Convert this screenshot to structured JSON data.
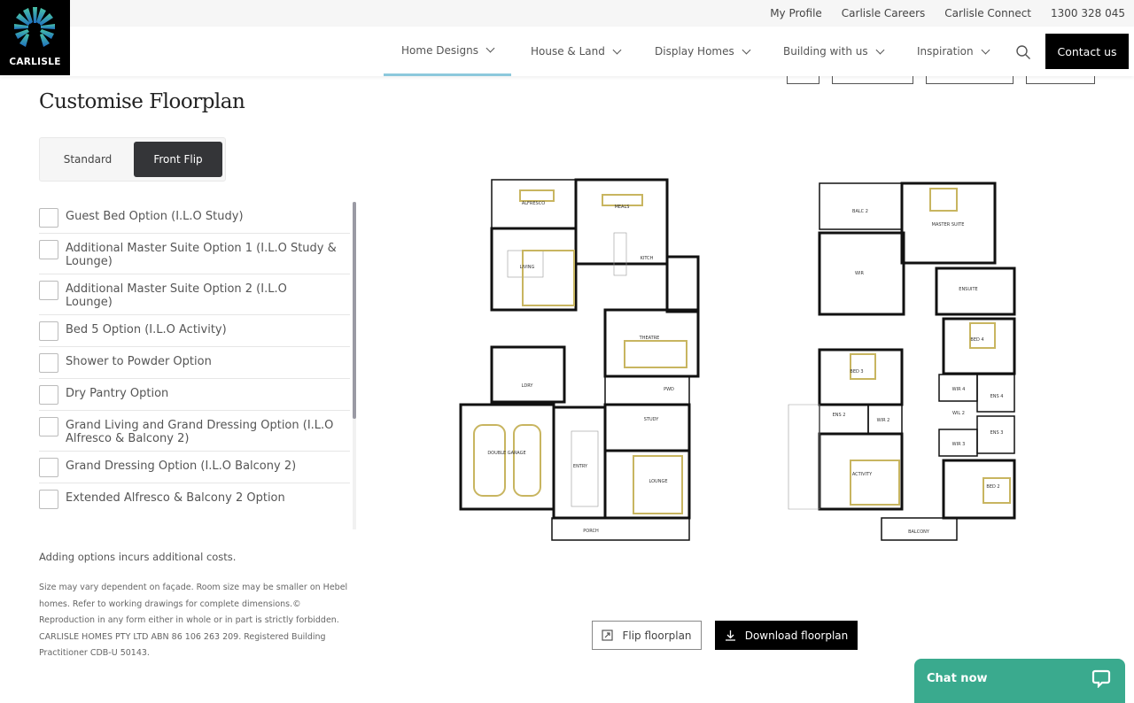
{
  "brand": {
    "name": "CARLISLE",
    "colors": {
      "logo_bg": "#000000",
      "accent": "#8cc8dc",
      "chat": "#3aaa8e",
      "active_toggle": "#343538"
    }
  },
  "topbar": {
    "links": [
      "My Profile",
      "Carlisle Careers",
      "Carlisle Connect",
      "1300 328 045"
    ]
  },
  "nav": {
    "items": [
      {
        "label": "Home Designs",
        "active": true
      },
      {
        "label": "House & Land"
      },
      {
        "label": "Display Homes"
      },
      {
        "label": "Building with us"
      },
      {
        "label": "Inspiration"
      }
    ],
    "search_icon": "search-icon",
    "contact": "Contact us"
  },
  "page": {
    "title": "Customise Floorplan"
  },
  "toggle": {
    "options": [
      "Standard",
      "Front Flip"
    ],
    "selected": "Front Flip"
  },
  "options": [
    {
      "label": "Guest Bed Option (I.L.O Study)",
      "checked": false
    },
    {
      "label": "Additional Master Suite Option 1 (I.L.O Study & Lounge)",
      "checked": false
    },
    {
      "label": "Additional Master Suite Option 2 (I.L.O Lounge)",
      "checked": false
    },
    {
      "label": "Bed 5 Option (I.L.O Activity)",
      "checked": false
    },
    {
      "label": "Shower to Powder Option",
      "checked": false
    },
    {
      "label": "Dry Pantry Option",
      "checked": false
    },
    {
      "label": "Grand Living and Grand Dressing Option (I.L.O Alfresco & Balcony 2)",
      "checked": false
    },
    {
      "label": "Grand Dressing Option (I.L.O Balcony 2)",
      "checked": false
    },
    {
      "label": "Extended Alfresco & Balcony 2 Option",
      "checked": false
    }
  ],
  "notes": {
    "costs": "Adding options incurs additional costs.",
    "disclaimer": "Size may vary dependent on façade. Room size may be smaller on Hebel homes. Refer to working drawings for complete dimensions.© Reproduction in any form either in whole or in part is strictly forbidden. CARLISLE HOMES PTY LTD ABN 86 106 263 209. Registered Building Practitioner CDB-U 50143."
  },
  "floorplan": {
    "ground": [
      "ALFRESCO",
      "MEALS",
      "KITCH",
      "LIVING",
      "THEATRE",
      "LDRY",
      "PWD",
      "STUDY",
      "ENTRY",
      "LOUNGE",
      "DOUBLE GARAGE",
      "PORCH"
    ],
    "upper": [
      "BALC 2",
      "MASTER SUITE",
      "WIR",
      "ENSUITE",
      "BED 4",
      "BED 3",
      "ENS 2",
      "WIR 2",
      "WIR 4",
      "ENS 4",
      "WIL 2",
      "ENS 3",
      "WIR 3",
      "ACTIVITY",
      "BED 2",
      "BALCONY"
    ]
  },
  "actions": {
    "flip": "Flip floorplan",
    "download": "Download floorplan"
  },
  "chat": {
    "label": "Chat now"
  }
}
